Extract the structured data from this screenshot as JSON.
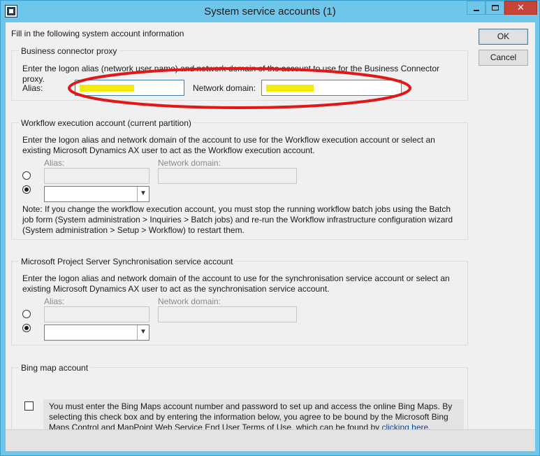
{
  "window": {
    "title": "System service accounts (1)",
    "minimize_glyph": "",
    "close_glyph": "✕"
  },
  "intro": "Fill in the following system account information",
  "buttons": {
    "ok": "OK",
    "cancel": "Cancel"
  },
  "business_connector": {
    "title": "Business connector proxy",
    "description": "Enter the logon alias (network user name) and network domain of the account to use for the Business Connector proxy.",
    "alias_label": "Alias:",
    "alias_value": "",
    "domain_label": "Network domain:",
    "domain_value": ""
  },
  "workflow": {
    "title": "Workflow execution account (current partition)",
    "description": "Enter the logon alias and network domain of the account to use for the Workflow execution account or select an existing Microsoft Dynamics AX user to act as the Workflow execution account.",
    "alias_label": "Alias:",
    "domain_label": "Network domain:",
    "selected_option": "user",
    "note": "Note: If you change the workflow execution account, you must stop the running workflow batch jobs using the Batch job form (System administration > Inquiries > Batch jobs) and re-run the Workflow infrastructure configuration wizard (System administration > Setup > Workflow) to restart them."
  },
  "project_server": {
    "title": "Microsoft Project Server Synchronisation service account",
    "description": "Enter the logon alias and network domain of the account to use for the synchronisation service account or select an existing Microsoft Dynamics AX user to act as the  synchronisation service account.",
    "alias_label": "Alias:",
    "domain_label": "Network domain:",
    "selected_option": "user"
  },
  "bing": {
    "title": "Bing map account",
    "checked": false,
    "text": "You must enter the Bing Maps account number and password to set up and access the online Bing Maps. By selecting this check box and by entering the information below, you agree to be bound by the Microsoft Bing Maps Control and MapPoint Web Service End User Terms of Use, which can be found by ",
    "link": "clicking here",
    "text_end": "."
  },
  "colors": {
    "titlebar": "#6ec6ea",
    "close": "#c8443a",
    "annotation": "#e01818",
    "redaction": "#f5ea10"
  },
  "icons": {
    "app": "dynamics-ax-icon",
    "minimize": "minimize-icon",
    "maximize": "maximize-icon",
    "close": "close-icon",
    "combo": "chevron-down-icon"
  }
}
